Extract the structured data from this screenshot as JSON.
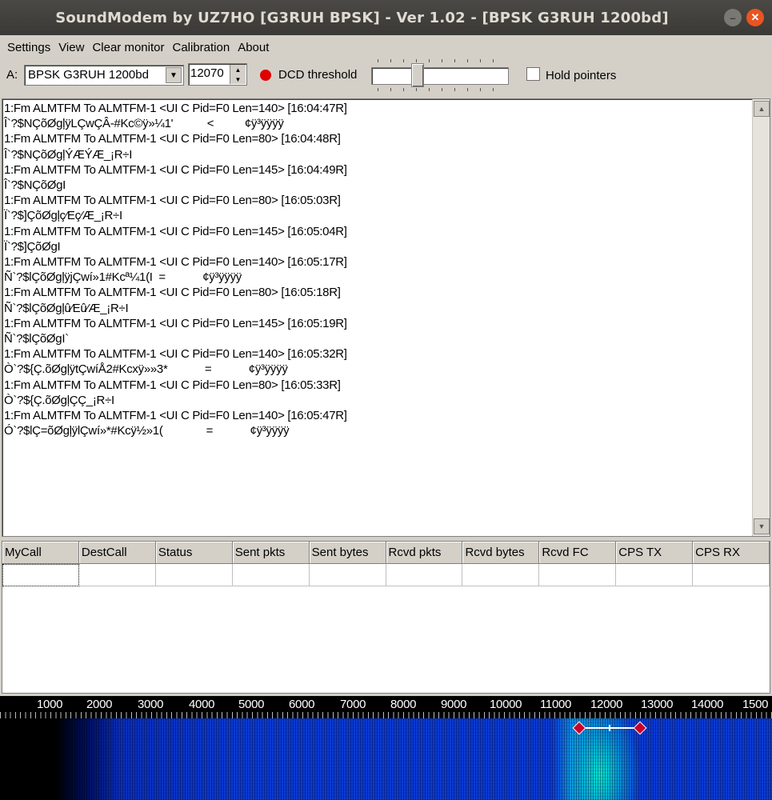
{
  "window": {
    "title": "SoundModem by UZ7HO [G3RUH BPSK] - Ver 1.02 - [BPSK G3RUH 1200bd]"
  },
  "menu": {
    "items": [
      {
        "label": "Settings"
      },
      {
        "label": "View"
      },
      {
        "label": "Clear monitor"
      },
      {
        "label": "Calibration"
      },
      {
        "label": "About"
      }
    ]
  },
  "toolbar": {
    "channel_label": "A:",
    "mode": "BPSK G3RUH 1200bd",
    "frequency": "12070",
    "dcd_label": "DCD threshold",
    "dcd_threshold_fraction": 0.33,
    "hold_pointers_label": "Hold pointers",
    "hold_pointers_checked": false,
    "colors": {
      "dcd_indicator": "#e00000"
    }
  },
  "monitor": {
    "lines": [
      "1:Fm ALMTFM To ALMTFM-1 <UI C Pid=F0 Len=140> [16:04:47R]",
      "Î`?$NÇõØgļÿLÇwÇÂ-#Kc©ÿ»¼1'           <          ¢ÿ³ÿÿÿÿ",
      "1:Fm ALMTFM To ALMTFM-1 <UI C Pid=F0 Len=80> [16:04:48R]",
      "Î`?$NÇõØgļÝÆÝÆ_¡R÷Ι",
      "1:Fm ALMTFM To ALMTFM-1 <UI C Pid=F0 Len=145> [16:04:49R]",
      "Î`?$NÇõØgΙ",
      "1:Fm ALMTFM To ALMTFM-1 <UI C Pid=F0 Len=80> [16:05:03R]",
      "Ï`?$]ÇõØgļç⁄Eç⁄Æ_¡R÷Ι",
      "1:Fm ALMTFM To ALMTFM-1 <UI C Pid=F0 Len=145> [16:05:04R]",
      "Ï`?$]ÇõØgΙ",
      "1:Fm ALMTFM To ALMTFM-1 <UI C Pid=F0 Len=140> [16:05:17R]",
      "Ñ`?$lÇõØgļÿjÇwí»1#Kcª¼1(Ι  =            ¢ÿ³ÿÿÿÿ",
      "1:Fm ALMTFM To ALMTFM-1 <UI C Pid=F0 Len=80> [16:05:18R]",
      "Ñ`?$lÇõØgļû⁄Eû⁄Æ_¡R÷Ι",
      "1:Fm ALMTFM To ALMTFM-1 <UI C Pid=F0 Len=145> [16:05:19R]",
      "Ñ`?$lÇõØgΙ`",
      "1:Fm ALMTFM To ALMTFM-1 <UI C Pid=F0 Len=140> [16:05:32R]",
      "Ò`?${Ç.õØgļÿtÇwíÅ2#Kcxÿ»»3*            =            ¢ÿ³ÿÿÿÿ",
      "1:Fm ALMTFM To ALMTFM-1 <UI C Pid=F0 Len=80> [16:05:33R]",
      "Ò`?${Ç.õØgļÇÇ_¡R÷Ι",
      "1:Fm ALMTFM To ALMTFM-1 <UI C Pid=F0 Len=140> [16:05:47R]",
      "Ó`?$lÇ=õØgļÿlÇwí»*#Kcÿ½»1(              =            ¢ÿ³ÿÿÿÿ"
    ]
  },
  "table": {
    "columns": [
      "MyCall",
      "DestCall",
      "Status",
      "Sent pkts",
      "Sent bytes",
      "Rcvd pkts",
      "Rcvd bytes",
      "Rcvd FC",
      "CPS TX",
      "CPS RX"
    ]
  },
  "waterfall": {
    "scale_labels": [
      "1000",
      "2000",
      "3000",
      "4000",
      "5000",
      "6000",
      "7000",
      "8000",
      "9000",
      "10000",
      "11000",
      "12000",
      "13000",
      "14000",
      "1500"
    ],
    "colors": {
      "background": "#0b3cd0",
      "signal": "#00ffc8",
      "marker": "#c8002a"
    }
  }
}
